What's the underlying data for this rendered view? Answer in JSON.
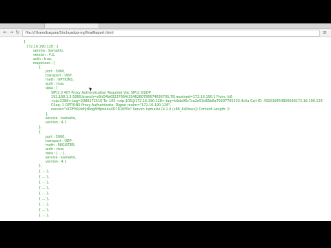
{
  "browser": {
    "url": "file:///Users/bagura/Sirchuadoo-ng/finalReport.html",
    "back_icon": "back-arrow-icon",
    "forward_icon": "forward-arrow-icon",
    "reload_icon": "reload-icon",
    "menu_icon": "menu-icon"
  },
  "json_lines": [
    "{",
    "172.16.190.128 : {",
    "service : kamailio,",
    "version : 4.1,",
    "auth : true,",
    "responses : [",
    "{",
    "port : 5060,",
    "transport : UDP,",
    "meth : OPTIONS,",
    "auth : true,",
    "data : [",
    "SIP/2.0 407 Proxy Authentication Required Via: SIP/2.0/UDP",
    "192.168.1.5:5060;branch=z9hG4bK0237664t3346260786674636705;78;received=172.16.190.1 From: fc6",
    "<sip:2386>;tag=2386172516 To: 105 <sip:105@172.16.190.128>;tag=b9de96c7ce2e53d65b6a79297765333.4c5a Call-ID: 432019454826690172.16.190.128",
    "CSeq: 1 OPTIONS Proxy-Authenticate: Digest realm=\"172.16.190.128\",",
    "nonce=\"VCPFNQcbhJtRdgMHJmd4aXD7R26FPo\" Server: kamailio (4.1.0 (x86_64/linux)) Content-Length: 0",
    "],",
    "service : kamailio,",
    "version : 4.1",
    "},",
    "{",
    "port : 5060,",
    "transport : UDP,",
    "meth : REGISTER,",
    "auth : true,",
    "data : [ ... ],",
    "service : kamailio,",
    "version : 4.1",
    "},",
    "{ ... },",
    "{ ... },",
    "{ ... },",
    "{ ... },",
    "{ ... },",
    "{ ... },",
    "{ ... },",
    "{ ... },",
    "{ ... },"
  ]
}
